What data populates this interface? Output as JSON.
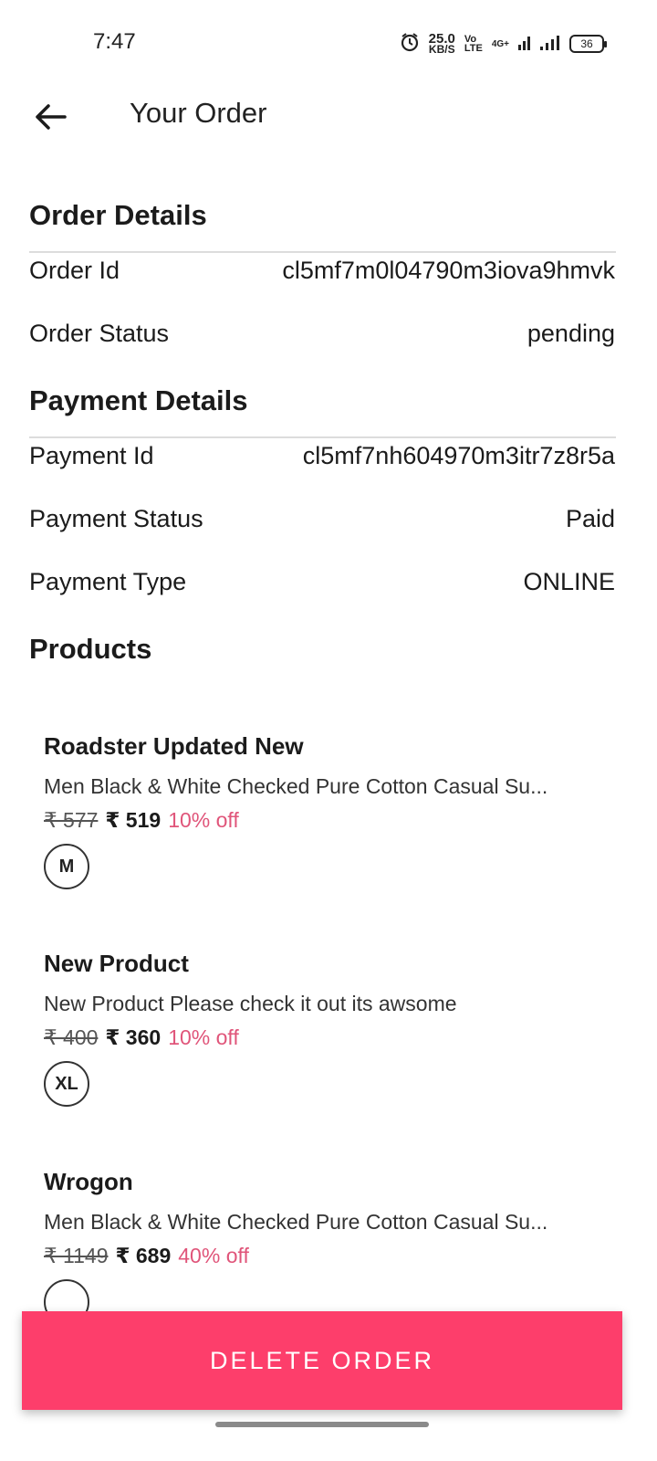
{
  "status_bar": {
    "time": "7:47",
    "speed_value": "25.0",
    "speed_unit": "KB/S",
    "volte": "Vo\nLTE",
    "network": "4G+",
    "battery": "36"
  },
  "header": {
    "back_icon": "arrow-left-icon",
    "title": "Your Order"
  },
  "order_details": {
    "title": "Order Details",
    "rows": [
      {
        "label": "Order Id",
        "value": "cl5mf7m0l04790m3iova9hmvk"
      },
      {
        "label": "Order Status",
        "value": "pending"
      }
    ]
  },
  "payment_details": {
    "title": "Payment Details",
    "rows": [
      {
        "label": "Payment Id",
        "value": "cl5mf7nh604970m3itr7z8r5a"
      },
      {
        "label": "Payment Status",
        "value": "Paid"
      },
      {
        "label": "Payment Type",
        "value": "ONLINE"
      }
    ]
  },
  "products": {
    "title": "Products",
    "items": [
      {
        "name": "Roadster Updated New",
        "description": "Men Black & White Checked Pure Cotton Casual Su...",
        "mrp": "₹ 577",
        "price": "₹ 519",
        "discount": "10% off",
        "size": "M"
      },
      {
        "name": "New Product",
        "description": "New Product Please check it out its awsome",
        "mrp": "₹ 400",
        "price": "₹ 360",
        "discount": "10% off",
        "size": "XL"
      },
      {
        "name": "Wrogon",
        "description": "Men Black & White Checked Pure Cotton Casual Su...",
        "mrp": "₹ 1149",
        "price": "₹ 689",
        "discount": "40% off",
        "size": ""
      }
    ]
  },
  "actions": {
    "delete_label": "DELETE ORDER"
  },
  "colors": {
    "accent": "#fd3e6b",
    "discount": "#e0557a"
  }
}
